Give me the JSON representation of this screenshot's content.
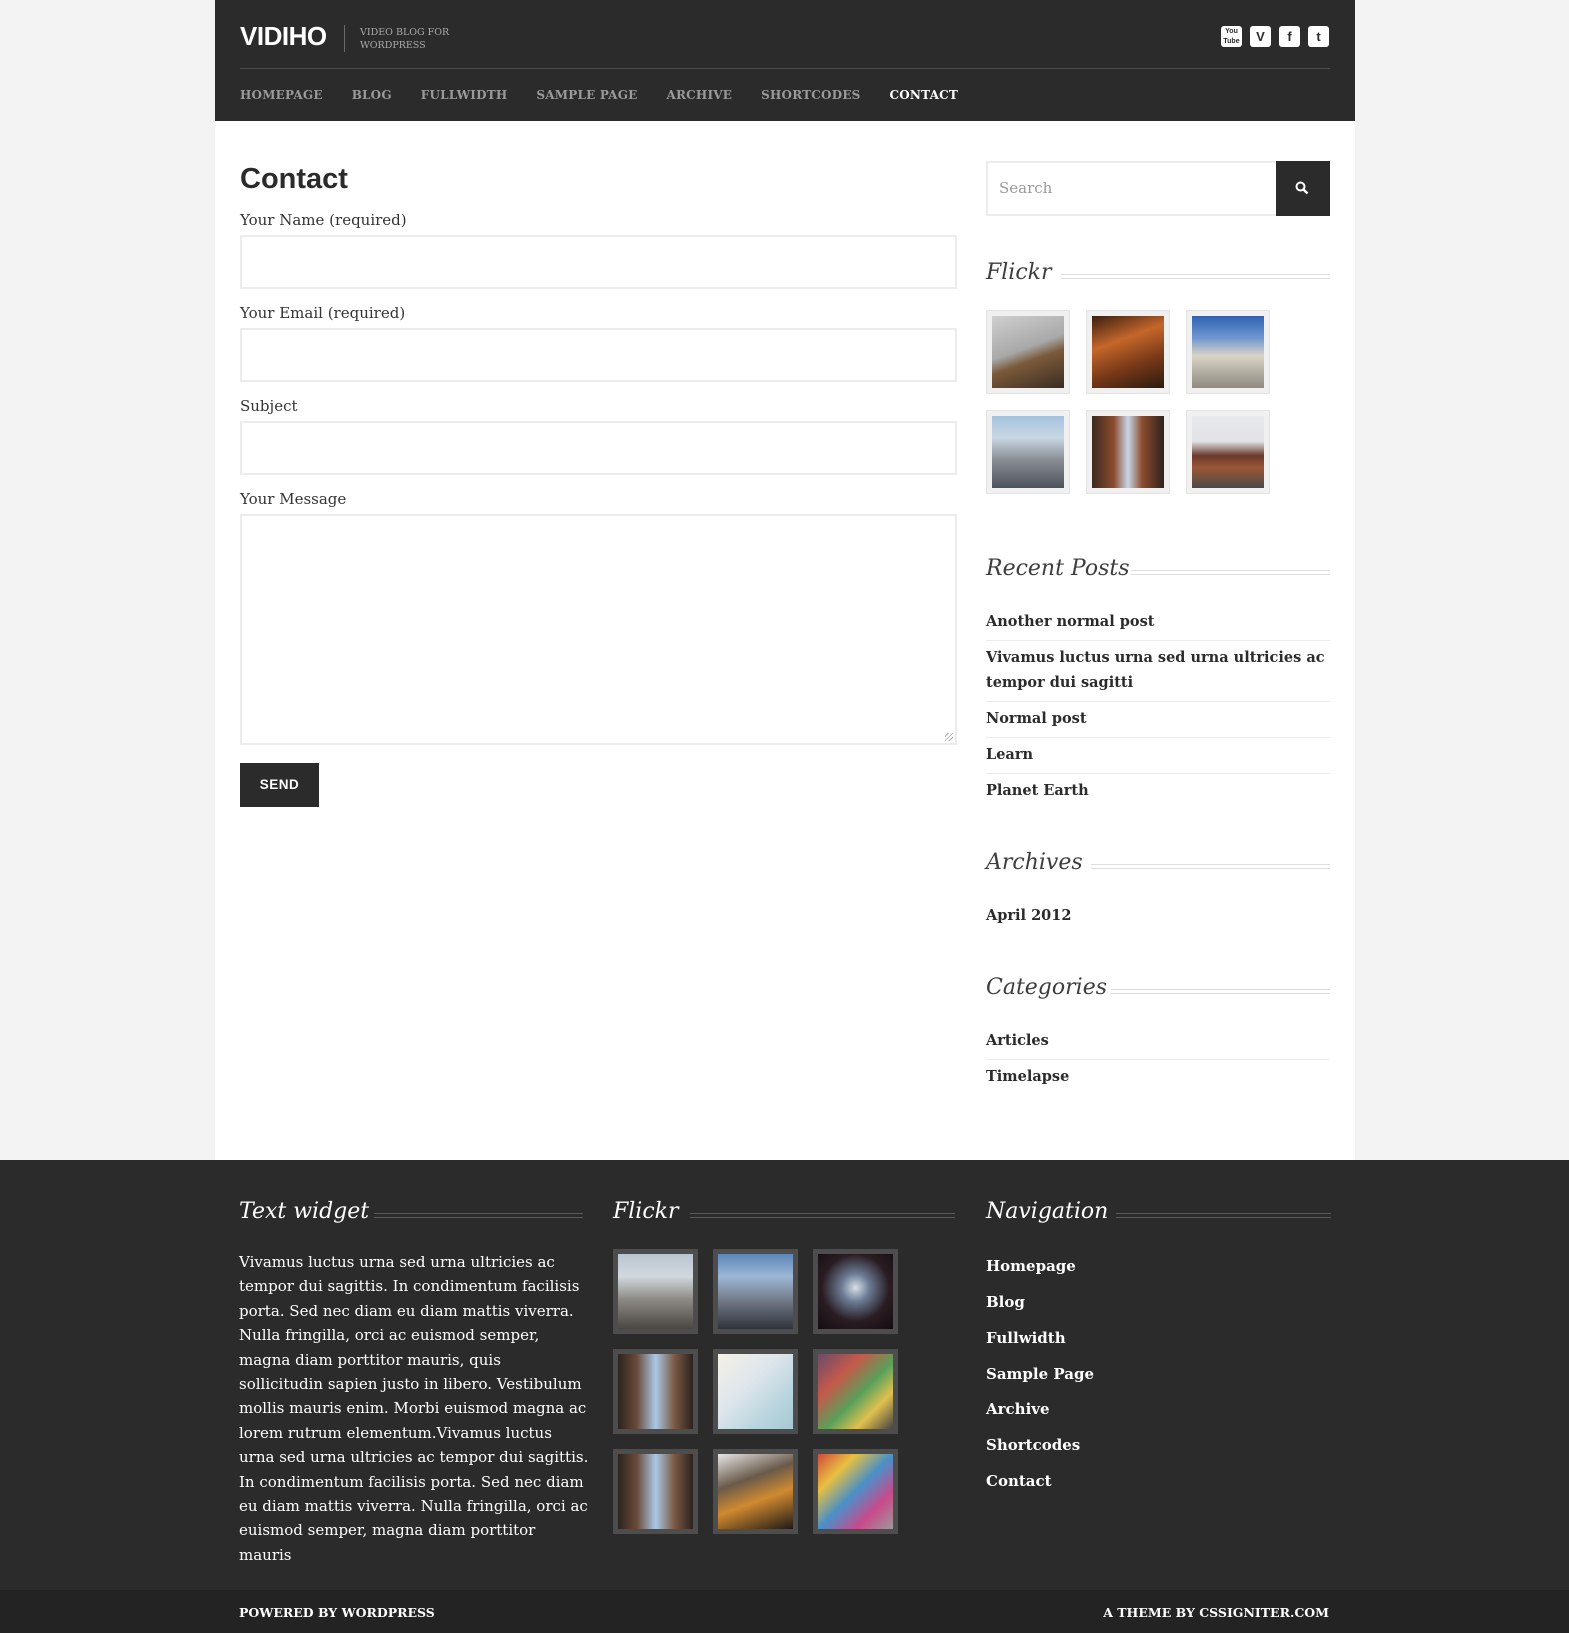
{
  "header": {
    "logo": "VIDIHO",
    "tagline": "VIDEO BLOG FOR WORDPRESS",
    "socials": [
      {
        "icon": "youtube-icon",
        "glyph": "You Tube"
      },
      {
        "icon": "vimeo-icon",
        "glyph": "V"
      },
      {
        "icon": "facebook-icon",
        "glyph": "f"
      },
      {
        "icon": "twitter-icon",
        "glyph": "t"
      }
    ],
    "nav": [
      "HOMEPAGE",
      "BLOG",
      "FULLWIDTH",
      "SAMPLE PAGE",
      "ARCHIVE",
      "SHORTCODES",
      "CONTACT"
    ],
    "active_nav": "CONTACT"
  },
  "form": {
    "title": "Contact",
    "name_label": "Your Name (required)",
    "email_label": "Your Email (required)",
    "subject_label": "Subject",
    "message_label": "Your Message",
    "send_label": "SEND"
  },
  "sidebar": {
    "search_placeholder": "Search",
    "flickr_title": "Flickr",
    "recent_title": "Recent Posts",
    "recent_posts": [
      "Another normal post",
      "Vivamus luctus urna sed urna ultricies ac tempor dui sagitti",
      "Normal post",
      "Learn",
      "Planet Earth"
    ],
    "archives_title": "Archives",
    "archives": [
      "April 2012"
    ],
    "categories_title": "Categories",
    "categories": [
      "Articles",
      "Timelapse"
    ]
  },
  "footer": {
    "text_title": "Text widget",
    "text_body": "Vivamus luctus urna sed urna ultricies ac tempor dui sagittis. In condimentum facilisis porta. Sed nec diam eu diam mattis viverra. Nulla fringilla, orci ac euismod semper, magna diam porttitor mauris, quis sollicitudin sapien justo in libero. Vestibulum mollis mauris enim. Morbi euismod magna ac lorem rutrum elementum.Vivamus luctus urna sed urna ultricies ac tempor dui sagittis. In condimentum facilisis porta. Sed nec diam eu diam mattis viverra. Nulla fringilla, orci ac euismod semper, magna diam porttitor mauris",
    "flickr_title": "Flickr",
    "nav_title": "Navigation",
    "nav_links": [
      "Homepage",
      "Blog",
      "Fullwidth",
      "Sample Page",
      "Archive",
      "Shortcodes",
      "Contact"
    ],
    "powered": "POWERED BY WORDPRESS",
    "credit": "A THEME BY CSSIGNITER.COM"
  },
  "colors": {
    "dark": "#2c2b2b",
    "footer_bar": "#242323",
    "page_bg": "#f3f3f3",
    "content_bg": "#ffffff"
  }
}
